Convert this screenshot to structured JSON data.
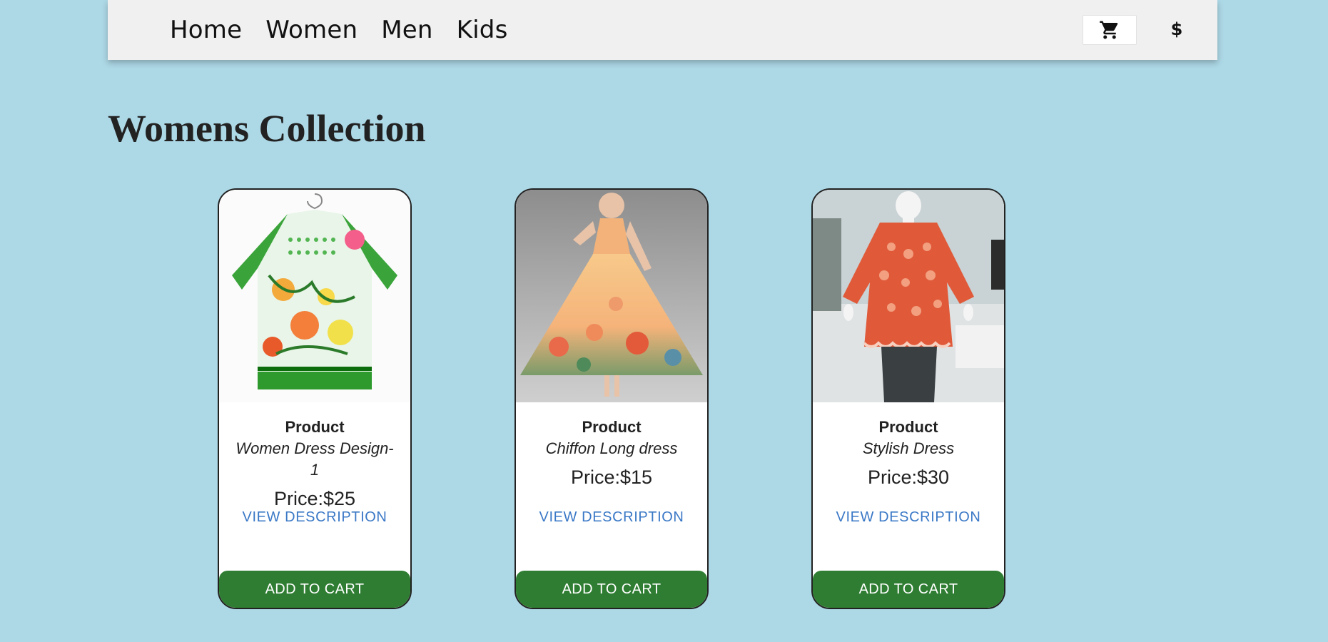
{
  "colors": {
    "background": "#add8e6",
    "navbar": "#f0f0f0",
    "add_to_cart_bg": "#2e7d32",
    "view_description_text": "#3a78c6"
  },
  "navbar": {
    "links": [
      {
        "label": "Home"
      },
      {
        "label": "Women"
      },
      {
        "label": "Men"
      },
      {
        "label": "Kids"
      }
    ],
    "cart_icon": "shopping-cart-icon",
    "currency_symbol": "$"
  },
  "page": {
    "title": "Womens Collection"
  },
  "products": [
    {
      "heading": "Product",
      "name": "Women Dress Design-1",
      "price": "Price:$25",
      "view_label": "VIEW DESCRIPTION",
      "cart_label": "ADD TO CART",
      "image_icon": "floral-kurta-dress-image"
    },
    {
      "heading": "Product",
      "name": "Chiffon Long dress",
      "price": "Price:$15",
      "view_label": "VIEW DESCRIPTION",
      "cart_label": "ADD TO CART",
      "image_icon": "floral-gown-image"
    },
    {
      "heading": "Product",
      "name": "Stylish Dress",
      "price": "Price:$30",
      "view_label": "VIEW DESCRIPTION",
      "cart_label": "ADD TO CART",
      "image_icon": "embroidered-top-image"
    }
  ]
}
